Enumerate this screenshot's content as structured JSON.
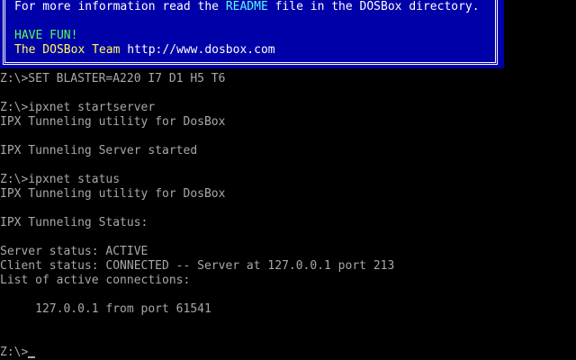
{
  "banner": {
    "line1_prefix": "For more information read the ",
    "line1_readme": "README",
    "line1_suffix": " file in the DOSBox directory.",
    "have_fun": "HAVE FUN!",
    "team_prefix": "The DOSBox Team ",
    "team_url": "http://www.dosbox.com"
  },
  "terminal": {
    "lines": [
      "Z:\\>SET BLASTER=A220 I7 D1 H5 T6",
      "",
      "Z:\\>ipxnet startserver",
      "IPX Tunneling utility for DosBox",
      "",
      "IPX Tunneling Server started",
      "",
      "Z:\\>ipxnet status",
      "IPX Tunneling utility for DosBox",
      "",
      "IPX Tunneling Status:",
      "",
      "Server status: ACTIVE",
      "Client status: CONNECTED -- Server at 127.0.0.1 port 213",
      "List of active connections:",
      "",
      "     127.0.0.1 from port 61541",
      "",
      ""
    ],
    "prompt": "Z:\\>"
  },
  "colors": {
    "banner_bg": "#0000a8",
    "text": "#a8a8a8",
    "highlight_cyan": "#55ffff",
    "highlight_yellow": "#ffff55",
    "highlight_green": "#55ff55"
  }
}
